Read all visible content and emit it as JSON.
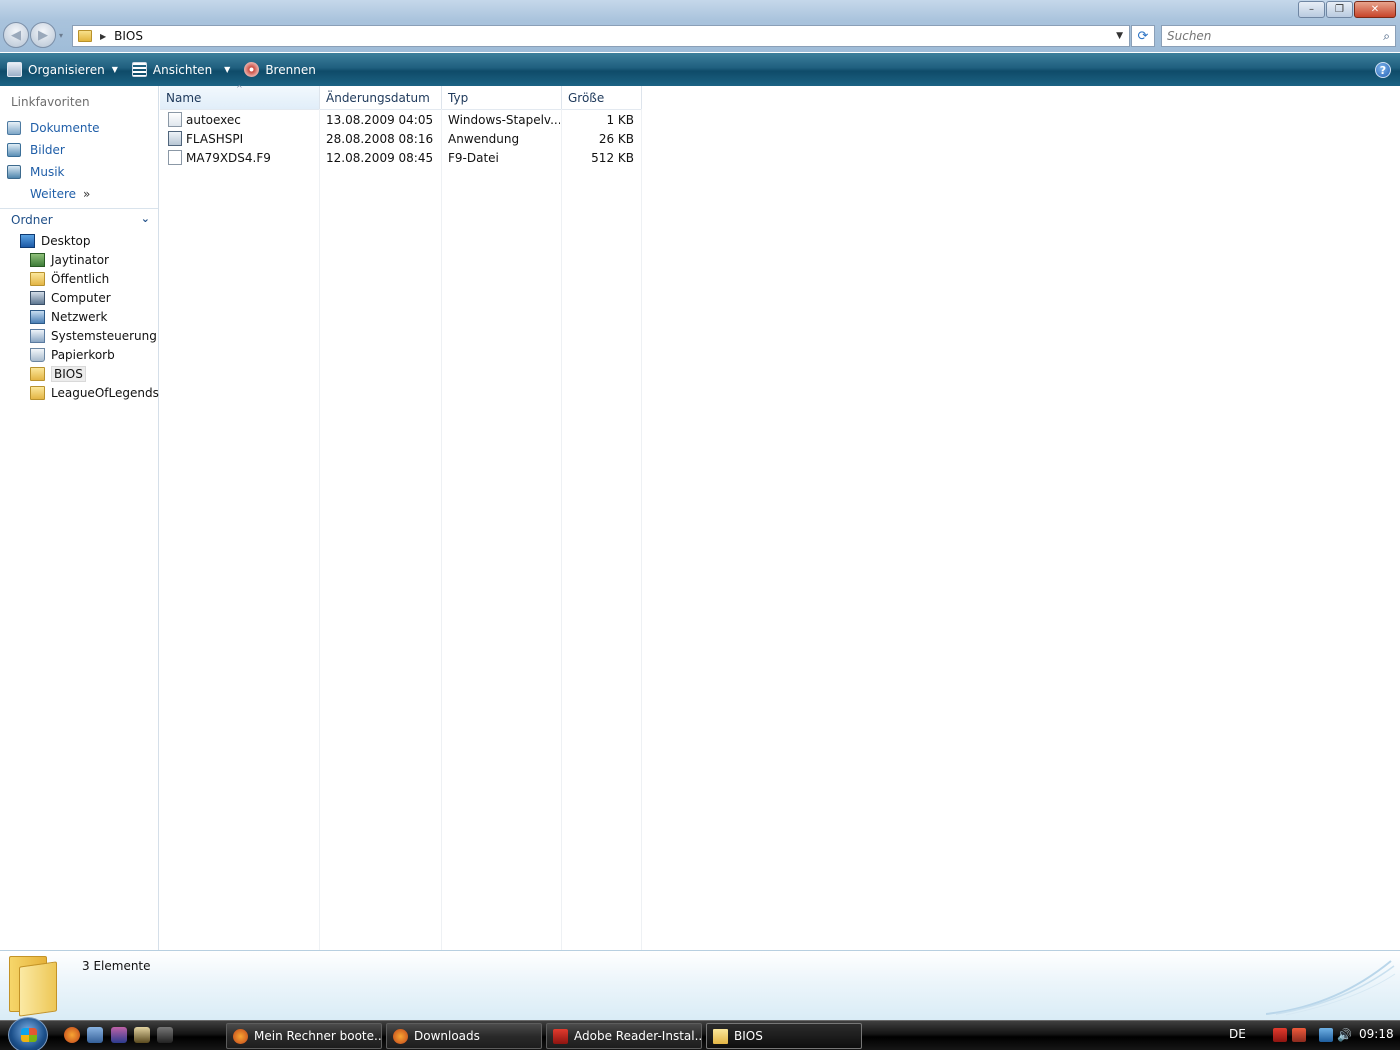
{
  "window": {
    "title": "BIOS",
    "controls": {
      "minimize": "–",
      "maximize": "❐",
      "close": "✕"
    }
  },
  "navigation": {
    "back_icon": "◀",
    "forward_icon": "▶",
    "dropdown_icon": "▾"
  },
  "address_bar": {
    "path": "BIOS",
    "separator_icon": "▶",
    "dropdown_icon": "▼"
  },
  "refresh_icon": "⟳",
  "search": {
    "placeholder": "Suchen",
    "icon": "⌕"
  },
  "toolbar": {
    "organize_label": "Organisieren",
    "views_label": "Ansichten",
    "burn_label": "Brennen",
    "caret": "▼",
    "help_label": "?"
  },
  "favorites": {
    "heading": "Linkfavoriten",
    "items": [
      {
        "label": "Dokumente",
        "icon": "documents-icon"
      },
      {
        "label": "Bilder",
        "icon": "pictures-icon"
      },
      {
        "label": "Musik",
        "icon": "music-icon"
      }
    ],
    "more_label": "Weitere",
    "more_icon": "»"
  },
  "folders": {
    "heading": "Ordner",
    "chevron": "⌄",
    "tree": [
      {
        "label": "Desktop",
        "icon": "desktop-icon",
        "level": 0
      },
      {
        "label": "Jaytinator",
        "icon": "user-folder-icon",
        "level": 1
      },
      {
        "label": "Öffentlich",
        "icon": "folder-icon",
        "level": 1
      },
      {
        "label": "Computer",
        "icon": "computer-icon",
        "level": 1
      },
      {
        "label": "Netzwerk",
        "icon": "network-icon",
        "level": 1
      },
      {
        "label": "Systemsteuerung",
        "icon": "control-panel-icon",
        "level": 1
      },
      {
        "label": "Papierkorb",
        "icon": "recycle-bin-icon",
        "level": 1
      },
      {
        "label": "BIOS",
        "icon": "folder-icon",
        "level": 1,
        "selected": true
      },
      {
        "label": "LeagueOfLegends",
        "icon": "folder-icon",
        "level": 1
      }
    ]
  },
  "file_list": {
    "columns": [
      "Name",
      "Änderungsdatum",
      "Typ",
      "Größe"
    ],
    "sort_indicator": "^",
    "rows": [
      {
        "name": "autoexec",
        "date": "13.08.2009 04:05",
        "type": "Windows-Stapelv...",
        "size": "1 KB",
        "icon": "batch-file-icon"
      },
      {
        "name": "FLASHSPI",
        "date": "28.08.2008 08:16",
        "type": "Anwendung",
        "size": "26 KB",
        "icon": "application-icon"
      },
      {
        "name": "MA79XDS4.F9",
        "date": "12.08.2009 08:45",
        "type": "F9-Datei",
        "size": "512 KB",
        "icon": "generic-file-icon"
      }
    ]
  },
  "details_pane": {
    "text": "3 Elemente"
  },
  "taskbar": {
    "tasks": [
      {
        "label": "Mein Rechner boote...",
        "icon": "firefox-icon"
      },
      {
        "label": "Downloads",
        "icon": "firefox-icon"
      },
      {
        "label": "Adobe Reader-Instal...",
        "icon": "adobe-reader-icon"
      },
      {
        "label": "BIOS",
        "icon": "folder-icon",
        "active": true
      }
    ],
    "language": "DE",
    "volume_icon": "🔊",
    "clock": "09:18"
  }
}
